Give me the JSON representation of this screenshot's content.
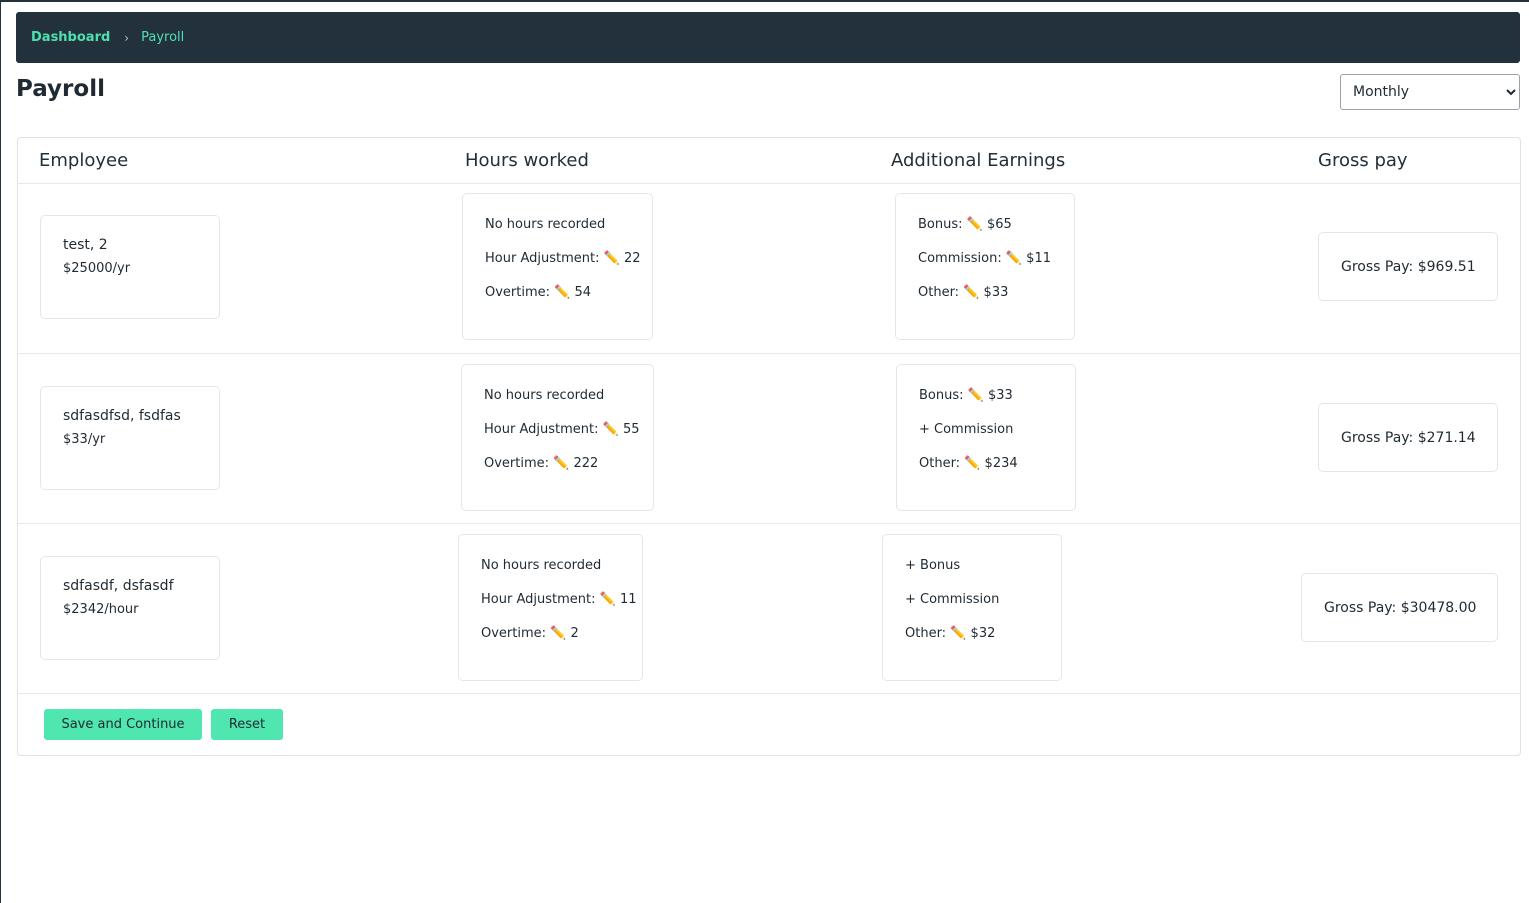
{
  "breadcrumb": {
    "home": "Dashboard",
    "separator": "›",
    "current": "Payroll"
  },
  "page": {
    "title": "Payroll"
  },
  "period": {
    "selected": "Monthly"
  },
  "table": {
    "headers": [
      "Employee",
      "Hours worked",
      "Additional Earnings",
      "Gross pay"
    ],
    "rows": [
      {
        "employee": {
          "name": "test, 2",
          "rate": "$25000/yr"
        },
        "hours": {
          "status": "No hours recorded",
          "adjustment_label": "Hour Adjustment:",
          "adjustment_value": "22",
          "overtime_label": "Overtime:",
          "overtime_value": "54"
        },
        "earnings": [
          {
            "label": "Bonus:",
            "value": "$65"
          },
          {
            "label": "Commission:",
            "value": "$11"
          },
          {
            "label": "Other:",
            "value": "$33"
          }
        ],
        "gross": "Gross Pay: $969.51"
      },
      {
        "employee": {
          "name": "sdfasdfsd, fsdfas",
          "rate": "$33/yr"
        },
        "hours": {
          "status": "No hours recorded",
          "adjustment_label": "Hour Adjustment:",
          "adjustment_value": "55",
          "overtime_label": "Overtime:",
          "overtime_value": "222"
        },
        "earnings": [
          {
            "label": "Bonus:",
            "value": "$33"
          },
          {
            "add": "+ Commission"
          },
          {
            "label": "Other:",
            "value": "$234"
          }
        ],
        "gross": "Gross Pay: $271.14"
      },
      {
        "employee": {
          "name": "sdfasdf, dsfasdf",
          "rate": "$2342/hour"
        },
        "hours": {
          "status": "No hours recorded",
          "adjustment_label": "Hour Adjustment:",
          "adjustment_value": "11",
          "overtime_label": "Overtime:",
          "overtime_value": "2"
        },
        "earnings": [
          {
            "add": "+ Bonus"
          },
          {
            "add": "+ Commission"
          },
          {
            "label": "Other:",
            "value": "$32"
          }
        ],
        "gross": "Gross Pay: $30478.00"
      }
    ]
  },
  "icons": {
    "edit": "pencil-icon",
    "edit_glyph": "✏️"
  },
  "actions": {
    "save_label": "Save and Continue",
    "reset_label": "Reset"
  },
  "colors": {
    "nav_bg": "#22313c",
    "accent": "#4fe6b0",
    "link": "#4fe0b0"
  }
}
